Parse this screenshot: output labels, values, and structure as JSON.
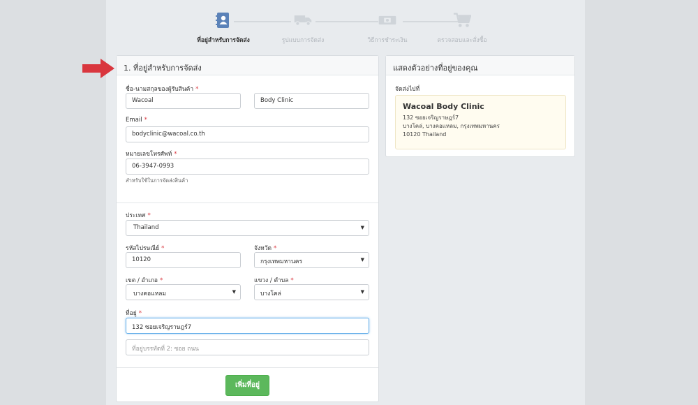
{
  "stepper": {
    "steps": [
      {
        "label": "ที่อยู่สำหรับการจัดส่ง",
        "icon": "address-book-icon",
        "active": true
      },
      {
        "label": "รูปแบบการจัดส่ง",
        "icon": "truck-icon",
        "active": false
      },
      {
        "label": "วิธีการชำระเงิน",
        "icon": "payment-card-icon",
        "active": false
      },
      {
        "label": "ตรวจสอบและสั่งซื้อ",
        "icon": "cart-icon",
        "active": false
      }
    ]
  },
  "form": {
    "title": "1. ที่อยู่สำหรับการจัดส่ง",
    "name_label": "ชื่อ-นามสกุลของผู้รับสินค้า",
    "first_name": "Wacoal",
    "last_name": "Body Clinic",
    "email_label": "Email",
    "email": "bodyclinic@wacoal.co.th",
    "phone_label": "หมายเลขโทรศัพท์",
    "phone": "06-3947-0993",
    "phone_hint": "สำหรับใช้ในการจัดส่งสินค้า",
    "country_label": "ประเทศ",
    "country": "Thailand",
    "postcode_label": "รหัสไปรษณีย์",
    "postcode": "10120",
    "province_label": "จังหวัด",
    "province": "กรุงเทพมหานคร",
    "district_label": "เขต / อำเภอ",
    "district": "บางคอแหลม",
    "subdistrict_label": "แขวง / ตำบล",
    "subdistrict": "บางโคล่",
    "address_label": "ที่อยู่",
    "address1": "132 ซอยเจริญราษฎร์7",
    "address2_placeholder": "ที่อยู่บรรทัดที่ 2: ซอย ถนน",
    "required_mark": "*",
    "add_button": "เพิ่มที่อยู่"
  },
  "preview": {
    "title": "แสดงตัวอย่างที่อยู่ของคุณ",
    "ship_to_label": "จัดส่งไปที่",
    "name": "Wacoal Body Clinic",
    "line1": "132 ซอยเจริญราษฎร์7",
    "line2": "บางโคล่, บางคอแหลม, กรุงเทพมหานคร",
    "line3": "10120 Thailand"
  },
  "colors": {
    "accent_arrow": "#d9363e",
    "button_green": "#5cb85c",
    "focus_blue": "#66afe9"
  }
}
